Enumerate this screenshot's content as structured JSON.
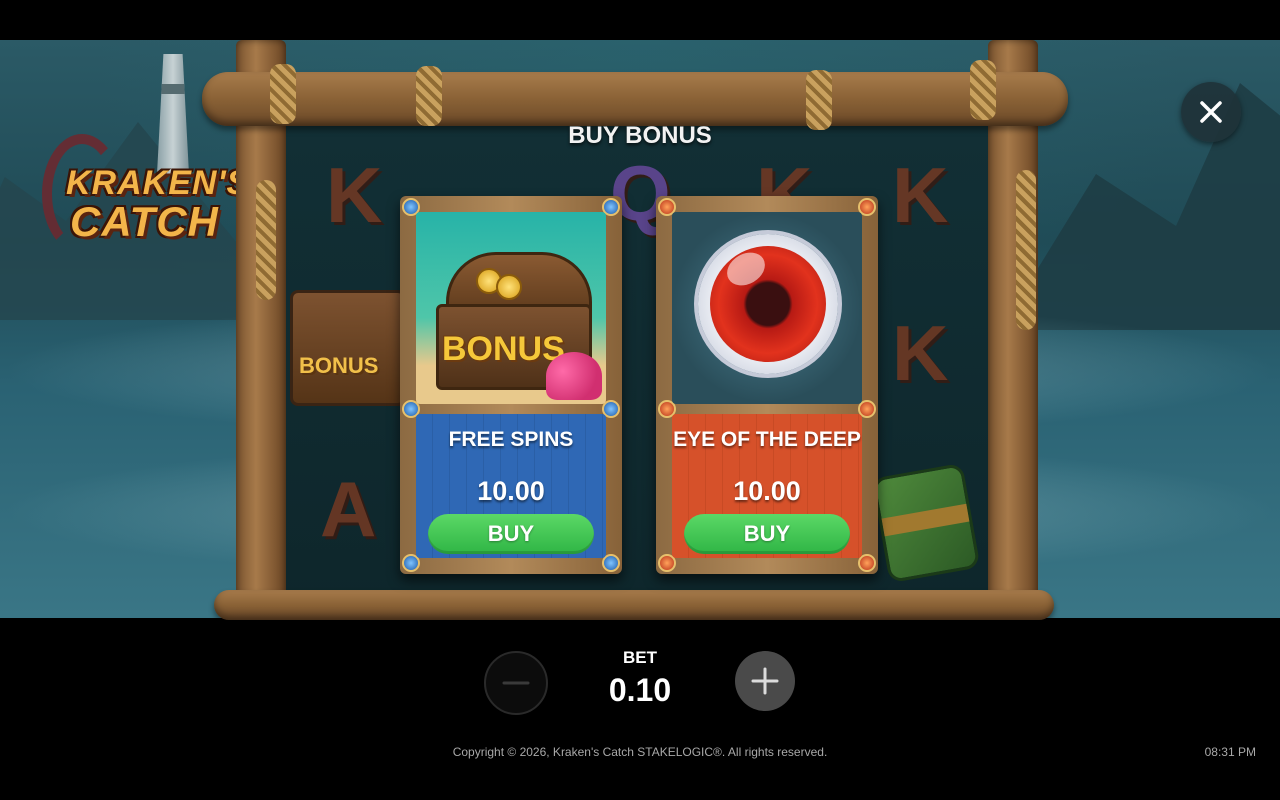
{
  "game": {
    "logo_line1": "KRAKEN'S",
    "logo_line2": "CATCH",
    "title": "BUY BONUS"
  },
  "background_symbols": [
    "K",
    "K",
    "K",
    "K",
    "A",
    "Q"
  ],
  "bonus_options": [
    {
      "art_label": "BONUS",
      "name": "FREE SPINS",
      "price": "10.00",
      "button_label": "BUY",
      "color": "#2f68b5"
    },
    {
      "art_label": "",
      "name": "EYE OF THE DEEP",
      "price": "10.00",
      "button_label": "BUY",
      "color": "#d6512a"
    }
  ],
  "background_chest_label": "BONUS",
  "bet": {
    "label": "BET",
    "value": "0.10"
  },
  "footer": {
    "copyright": "Copyright © 2026, Kraken's Catch STAKELOGIC®. All rights reserved.",
    "time": "08:31 PM"
  },
  "colors": {
    "buy_button": "#2fb545",
    "free_spins_panel": "#2f68b5",
    "eye_panel": "#d6512a"
  }
}
